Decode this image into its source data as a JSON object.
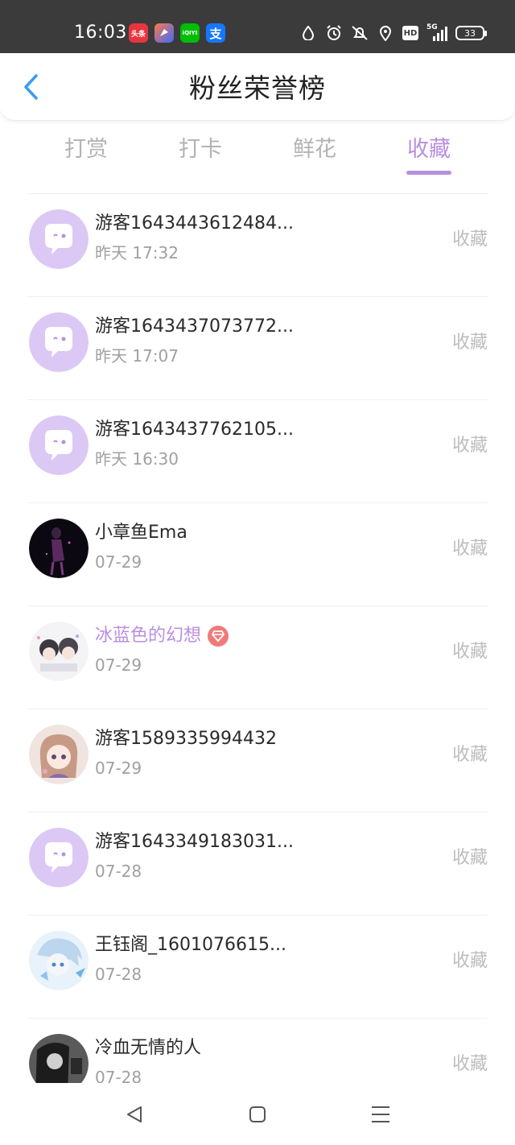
{
  "status_bar": {
    "time": "16:03",
    "apps": [
      {
        "name": "toutiao",
        "label": "头条"
      },
      {
        "name": "feishu",
        "label": ""
      },
      {
        "name": "iqiyi",
        "label": "iQIYI"
      },
      {
        "name": "alipay",
        "label": "支"
      }
    ],
    "hd": "HD",
    "network": "5G",
    "battery": "33"
  },
  "header": {
    "title": "粉丝荣誉榜",
    "back_icon": "chevron-left-icon"
  },
  "tabs": [
    {
      "label": "打赏",
      "active": false
    },
    {
      "label": "打卡",
      "active": false
    },
    {
      "label": "鲜花",
      "active": false
    },
    {
      "label": "收藏",
      "active": true
    }
  ],
  "list": [
    {
      "name": "游客1643443612484...",
      "time": "昨天 17:32",
      "action": "收藏",
      "avatar": "default-chat-avatar",
      "vip": false
    },
    {
      "name": "游客1643437073772...",
      "time": "昨天 17:07",
      "action": "收藏",
      "avatar": "default-chat-avatar",
      "vip": false
    },
    {
      "name": "游客1643437762105...",
      "time": "昨天 16:30",
      "action": "收藏",
      "avatar": "default-chat-avatar",
      "vip": false
    },
    {
      "name": "小章鱼Ema",
      "time": "07-29",
      "action": "收藏",
      "avatar": "photo-dark-figure",
      "vip": false
    },
    {
      "name": "冰蓝色的幻想",
      "time": "07-29",
      "action": "收藏",
      "avatar": "photo-anime-couple",
      "vip": true
    },
    {
      "name": "游客1589335994432",
      "time": "07-29",
      "action": "收藏",
      "avatar": "photo-anime-girl",
      "vip": false
    },
    {
      "name": "游客1643349183031...",
      "time": "07-28",
      "action": "收藏",
      "avatar": "default-chat-avatar",
      "vip": false
    },
    {
      "name": "王钰阁_1601076615...",
      "time": "07-28",
      "action": "收藏",
      "avatar": "photo-anime-blue",
      "vip": false
    },
    {
      "name": "冷血无情的人",
      "time": "07-28",
      "action": "收藏",
      "avatar": "photo-bw-portrait",
      "vip": false
    }
  ],
  "colors": {
    "accent": "#b88fe0",
    "avatar_bg": "#dcc8f4",
    "status_bar": "#3b3b3b",
    "vip_badge": "#f07a7a"
  },
  "nav": [
    "back-triangle-icon",
    "home-square-icon",
    "menu-lines-icon"
  ]
}
